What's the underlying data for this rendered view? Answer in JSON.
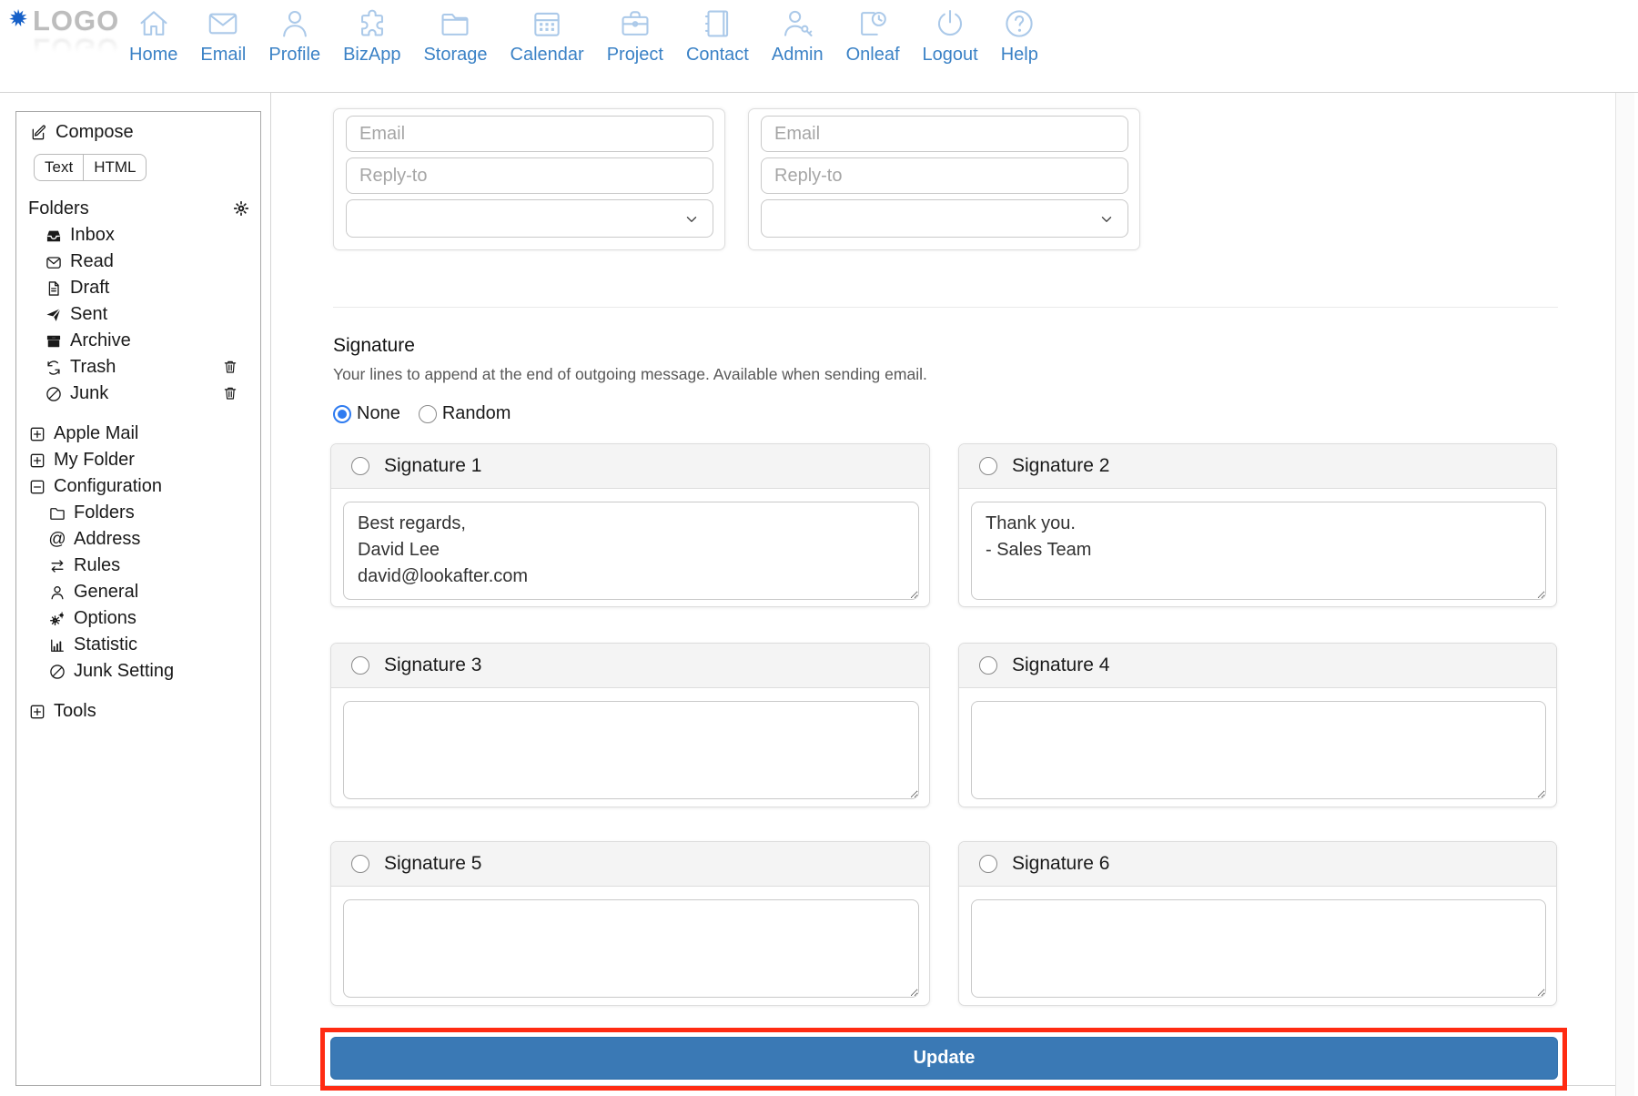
{
  "logo": {
    "text": "LOGO"
  },
  "nav": {
    "items": [
      {
        "label": "Home",
        "icon": "home-icon"
      },
      {
        "label": "Email",
        "icon": "envelope-icon"
      },
      {
        "label": "Profile",
        "icon": "person-icon"
      },
      {
        "label": "BizApp",
        "icon": "puzzle-icon"
      },
      {
        "label": "Storage",
        "icon": "folder-icon"
      },
      {
        "label": "Calendar",
        "icon": "calendar-icon"
      },
      {
        "label": "Project",
        "icon": "briefcase-icon"
      },
      {
        "label": "Contact",
        "icon": "address-book-icon"
      },
      {
        "label": "Admin",
        "icon": "user-key-icon"
      },
      {
        "label": "Onleaf",
        "icon": "document-clock-icon"
      },
      {
        "label": "Logout",
        "icon": "power-icon"
      },
      {
        "label": "Help",
        "icon": "question-circle-icon"
      }
    ]
  },
  "sidebar": {
    "compose": {
      "label": "Compose",
      "icon": "compose-icon",
      "mode_buttons": [
        "Text",
        "HTML"
      ]
    },
    "folders_section": {
      "title": "Folders",
      "settings_icon": "gear-icon",
      "items": [
        {
          "label": "Inbox",
          "icon": "inbox-icon"
        },
        {
          "label": "Read",
          "icon": "mail-open-icon"
        },
        {
          "label": "Draft",
          "icon": "draft-icon"
        },
        {
          "label": "Sent",
          "icon": "paper-plane-icon"
        },
        {
          "label": "Archive",
          "icon": "archive-icon"
        },
        {
          "label": "Trash",
          "icon": "recycle-icon",
          "trailing_icon": "trash-icon"
        },
        {
          "label": "Junk",
          "icon": "block-icon",
          "trailing_icon": "trash-icon"
        }
      ]
    },
    "tree": {
      "apple_mail": {
        "label": "Apple Mail",
        "state": "collapsed",
        "toggle_icon": "plus-box-icon"
      },
      "my_folder": {
        "label": "My Folder",
        "state": "collapsed",
        "toggle_icon": "plus-box-icon"
      },
      "configuration": {
        "label": "Configuration",
        "state": "expanded",
        "toggle_icon": "minus-box-icon",
        "children": [
          {
            "label": "Folders",
            "icon": "folder-icon"
          },
          {
            "label": "Address",
            "icon": "at-icon"
          },
          {
            "label": "Rules",
            "icon": "swap-arrows-icon"
          },
          {
            "label": "General",
            "icon": "person-icon"
          },
          {
            "label": "Options",
            "icon": "gears-icon"
          },
          {
            "label": "Statistic",
            "icon": "bar-chart-icon"
          },
          {
            "label": "Junk Setting",
            "icon": "block-icon"
          }
        ]
      },
      "tools": {
        "label": "Tools",
        "state": "collapsed",
        "toggle_icon": "plus-box-icon"
      }
    }
  },
  "identities": {
    "cards": [
      {
        "email_placeholder": "Email",
        "email_value": "",
        "replyto_placeholder": "Reply-to",
        "replyto_value": "",
        "select_value": ""
      },
      {
        "email_placeholder": "Email",
        "email_value": "",
        "replyto_placeholder": "Reply-to",
        "replyto_value": "",
        "select_value": ""
      }
    ]
  },
  "signature": {
    "title": "Signature",
    "subtitle": "Your lines to append at the end of outgoing message. Available when sending email.",
    "mode_options": [
      {
        "label": "None",
        "selected": true
      },
      {
        "label": "Random",
        "selected": false
      }
    ],
    "panels": [
      {
        "label": "Signature 1",
        "selected": false,
        "content": "Best regards,\nDavid Lee\ndavid@lookafter.com"
      },
      {
        "label": "Signature 2",
        "selected": false,
        "content": "Thank you.\n- Sales Team"
      },
      {
        "label": "Signature 3",
        "selected": false,
        "content": ""
      },
      {
        "label": "Signature 4",
        "selected": false,
        "content": ""
      },
      {
        "label": "Signature 5",
        "selected": false,
        "content": ""
      },
      {
        "label": "Signature 6",
        "selected": false,
        "content": ""
      }
    ],
    "update_label": "Update"
  },
  "annotation": {
    "highlight_color": "#ff2b12",
    "highlighted_element": "update-button"
  },
  "colors": {
    "nav_label_blue": "#3b82c6",
    "nav_icon_blue": "#abc9e9",
    "button_blue": "#3a79b5",
    "radio_selected_blue": "#2e7bf0",
    "panel_header_gray": "#f4f4f4",
    "highlight_red": "#ff2b12"
  }
}
